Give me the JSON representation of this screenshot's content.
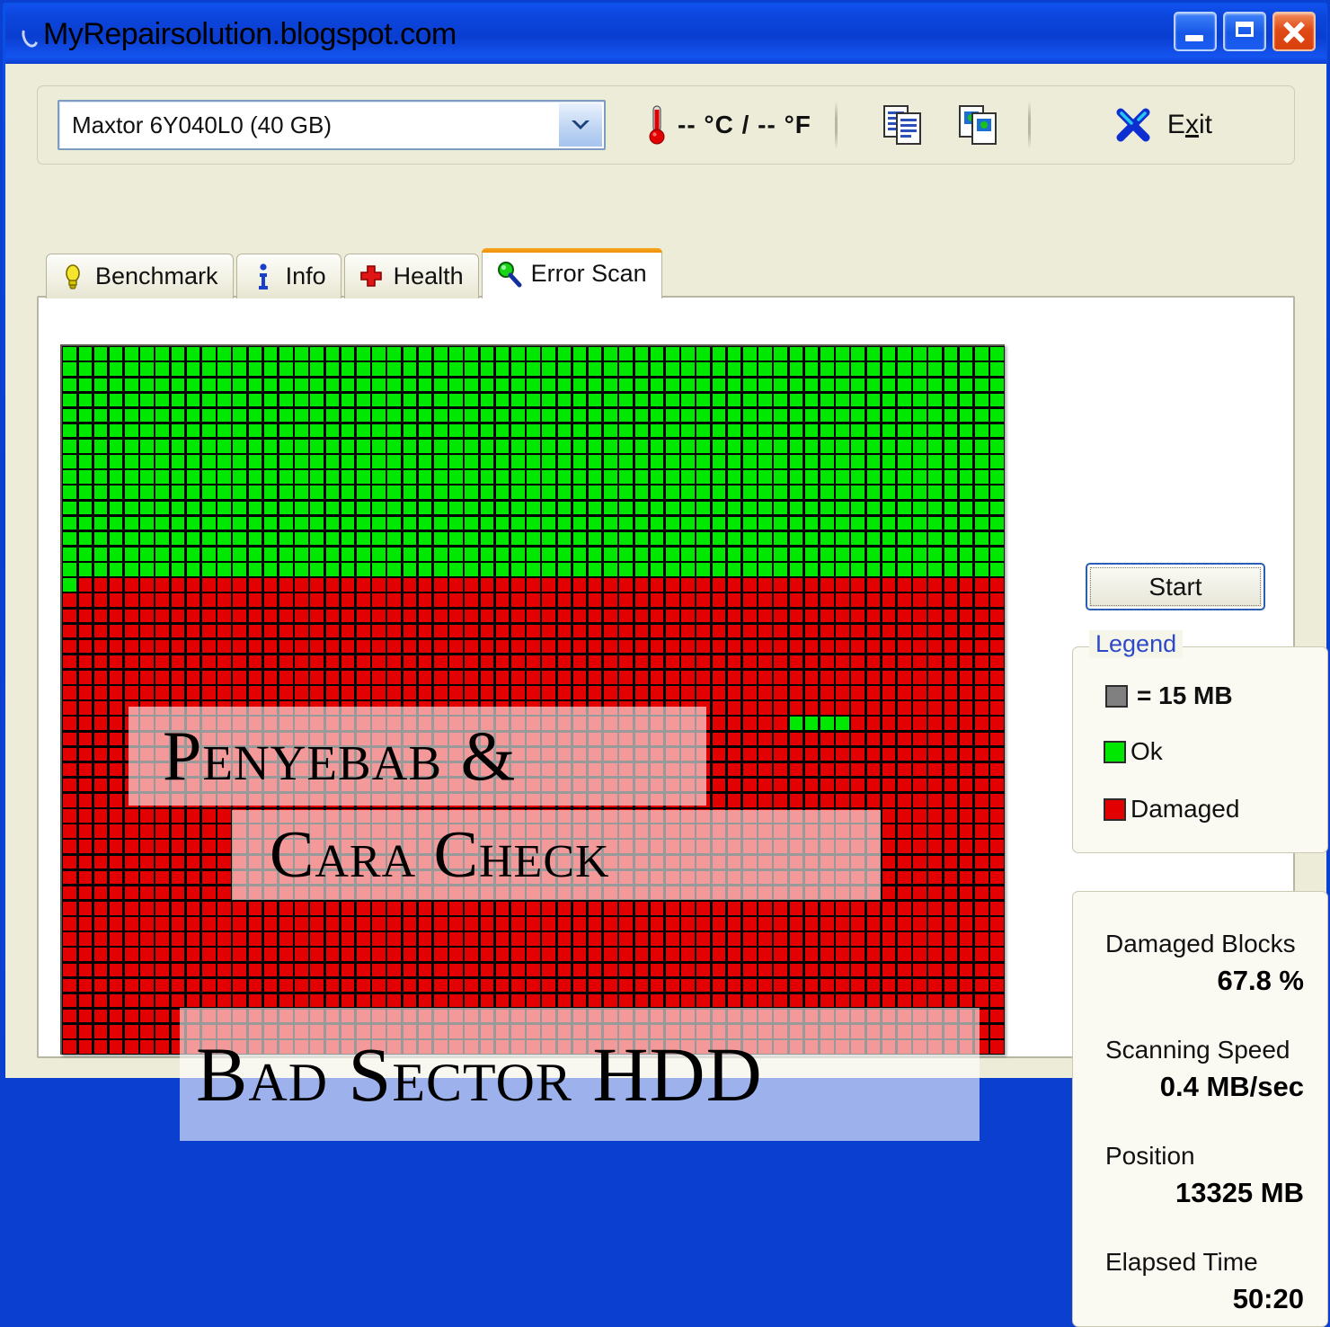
{
  "window": {
    "title": "MyRepairsolution.blogspot.com",
    "icon": "hdtune-logo-icon",
    "controls": {
      "minimize": "minimize-button",
      "maximize": "maximize-button",
      "close": "close-button"
    }
  },
  "toolbar": {
    "drive_selected": "Maxtor 6Y040L0 (40 GB)",
    "drive_options": [
      "Maxtor 6Y040L0 (40 GB)"
    ],
    "temperature": "-- °C / -- °F",
    "copy_text_icon": "copy-text-icon",
    "copy_screenshot_icon": "copy-screenshot-icon",
    "exit_label_pre": "E",
    "exit_label_accel": "x",
    "exit_label_post": "it",
    "exit_icon": "exit-x-icon"
  },
  "tabs": [
    {
      "label": "Benchmark",
      "icon": "benchmark-bulb-icon",
      "active": false
    },
    {
      "label": "Info",
      "icon": "info-icon",
      "active": false
    },
    {
      "label": "Health",
      "icon": "health-cross-icon",
      "active": false
    },
    {
      "label": "Error Scan",
      "icon": "error-scan-magnifier-icon",
      "active": true
    }
  ],
  "scan": {
    "start_button": "Start",
    "legend": {
      "title": "Legend",
      "block_size": "= 15 MB",
      "block_size_color": "#808080",
      "ok_label": "Ok",
      "ok_color": "#00e800",
      "damaged_label": "Damaged",
      "damaged_color": "#e30000"
    },
    "stats": [
      {
        "label": "Damaged Blocks",
        "value": "67.8 %"
      },
      {
        "label": "Scanning Speed",
        "value": "0.4 MB/sec"
      },
      {
        "label": "Position",
        "value": "13325 MB"
      },
      {
        "label": "Elapsed Time",
        "value": "50:20"
      }
    ]
  },
  "overlay_text": {
    "line1": "Penyebab &",
    "line2": "Cara Check",
    "line3": "Bad Sector HDD"
  },
  "chart_data": {
    "type": "heatmap",
    "title": "HDD Error Scan block map",
    "legend": [
      "Ok",
      "Damaged"
    ],
    "colors": {
      "ok": "#00e800",
      "damaged": "#e30000",
      "gridline": "#000000"
    },
    "block_size_mb": 15,
    "cols": 61,
    "rows": 46,
    "ok_rows": 15,
    "damaged_rows": 31,
    "ok_extra_block_row": 15,
    "ok_extra_block_col": 0,
    "ok_island": {
      "row": 24,
      "col_start": 47,
      "col_count": 4
    },
    "damaged_percent": 67.8,
    "position_mb": 13325,
    "scanning_speed_mb_per_sec": 0.4,
    "elapsed_time": "50:20",
    "major_divider_cols": [
      1,
      18,
      35,
      52
    ]
  }
}
